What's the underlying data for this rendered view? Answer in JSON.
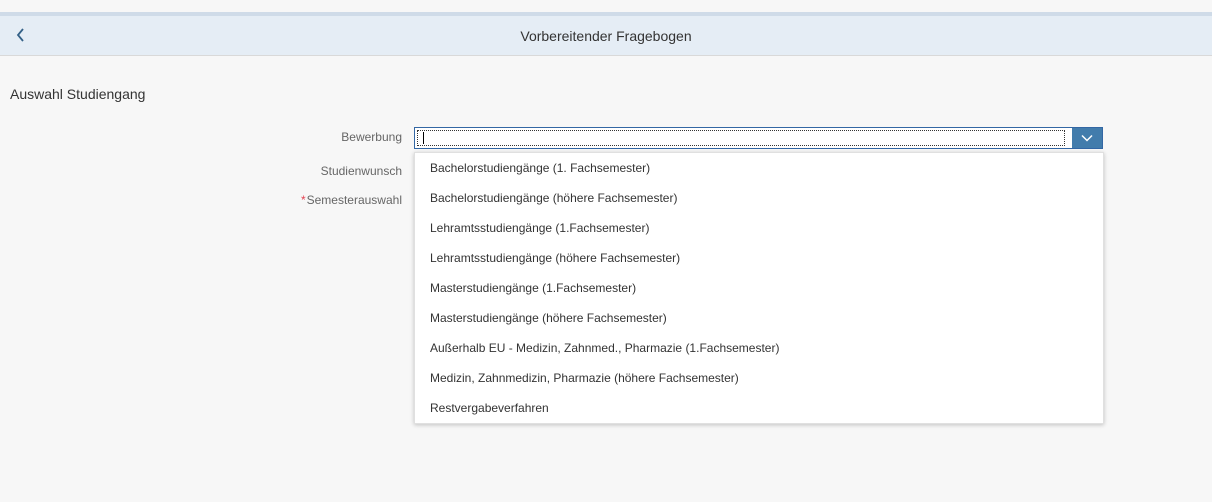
{
  "header": {
    "title": "Vorbereitender Fragebogen",
    "back_icon": "chevron-left-icon"
  },
  "section": {
    "title": "Auswahl Studiengang"
  },
  "form": {
    "bewerbung_label": "Bewerbung",
    "bewerbung_value": "",
    "studienwunsch_label": "Studienwunsch",
    "semester_required_mark": "*",
    "semester_label": "Semesterauswahl",
    "dropdown_icon": "chevron-down-icon"
  },
  "dropdown": {
    "options": [
      "Bachelorstudiengänge (1. Fachsemester)",
      "Bachelorstudiengänge (höhere Fachsemester)",
      "Lehramtsstudiengänge (1.Fachsemester)",
      "Lehramtsstudiengänge (höhere Fachsemester)",
      "Masterstudiengänge (1.Fachsemester)",
      "Masterstudiengänge (höhere Fachsemester)",
      "Außerhalb EU - Medizin, Zahnmed., Pharmazie (1.Fachsemester)",
      "Medizin, Zahnmedizin, Pharmazie (höhere Fachsemester)",
      "Restvergabeverfahren"
    ]
  },
  "colors": {
    "header_bg": "#e5edf5",
    "accent": "#427cac",
    "required": "#e34352",
    "page_bg": "#f7f7f7"
  }
}
